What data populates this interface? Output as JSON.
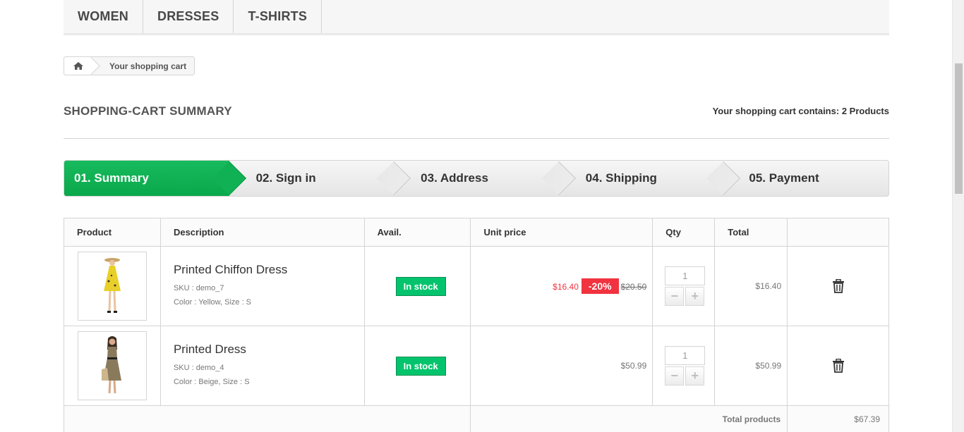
{
  "menu": {
    "items": [
      {
        "label": "Women"
      },
      {
        "label": "Dresses"
      },
      {
        "label": "T-shirts"
      }
    ]
  },
  "breadcrumb": {
    "home_icon": "home-icon",
    "current": "Your shopping cart"
  },
  "heading": {
    "title": "Shopping-cart summary",
    "count_prefix": "Your shopping cart contains:",
    "count_value": "2 Products"
  },
  "steps": [
    {
      "label": "01. Summary",
      "current": true
    },
    {
      "label": "02. Sign in",
      "current": false
    },
    {
      "label": "03. Address",
      "current": false
    },
    {
      "label": "04. Shipping",
      "current": false
    },
    {
      "label": "05. Payment",
      "current": false
    }
  ],
  "table": {
    "headers": {
      "product": "Product",
      "description": "Description",
      "avail": "Avail.",
      "unit_price": "Unit price",
      "qty": "Qty",
      "total": "Total"
    },
    "rows": [
      {
        "name": "Printed Chiffon Dress",
        "sku": "SKU : demo_7",
        "attributes": "Color : Yellow, Size : S",
        "availability": "In stock",
        "price_new": "$16.40",
        "discount": "-20%",
        "price_old": "$20.50",
        "qty": "1",
        "total": "$16.40",
        "dress_color": "#e8cf2a"
      },
      {
        "name": "Printed Dress",
        "sku": "SKU : demo_4",
        "attributes": "Color : Beige, Size : S",
        "availability": "In stock",
        "price": "$50.99",
        "qty": "1",
        "total": "$50.99",
        "dress_color": "#8a7a5c"
      }
    ],
    "footer": {
      "label": "Total products",
      "value": "$67.39"
    }
  },
  "colors": {
    "accent_green": "#0aa84b",
    "sale_red": "#f13340"
  }
}
